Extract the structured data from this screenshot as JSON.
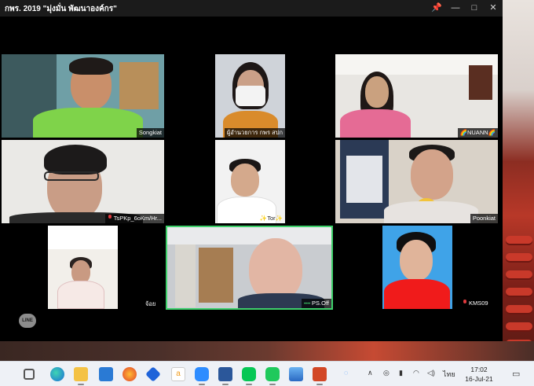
{
  "window": {
    "title": "กพร. 2019 \"มุ่งมั่น พัฒนาองค์กร\"",
    "controls": [
      "pin",
      "minimize",
      "maximize",
      "close"
    ]
  },
  "participants": [
    {
      "name": "Songkiat",
      "mic_muted": false,
      "active_speaker": false
    },
    {
      "name": "ผู้อำนวยการ กพร สปก",
      "mic_muted": false,
      "active_speaker": false
    },
    {
      "name": "🌈NUANN🌈",
      "mic_muted": false,
      "active_speaker": false
    },
    {
      "name": "TsPKp_6oKm/Hr...",
      "mic_muted": true,
      "active_speaker": false
    },
    {
      "name": "✨Tor✨",
      "mic_muted": false,
      "active_speaker": false
    },
    {
      "name": "Poonkiat",
      "mic_muted": false,
      "active_speaker": false
    },
    {
      "name": "จ้อย",
      "mic_muted": false,
      "active_speaker": false
    },
    {
      "name": "PS.Off",
      "mic_muted": false,
      "active_speaker": true
    },
    {
      "name": "KMS09",
      "mic_muted": true,
      "active_speaker": false
    }
  ],
  "overlay": {
    "line_logo": "LINE"
  },
  "taskbar": {
    "apps": [
      "task-view",
      "edge",
      "file-explorer",
      "mail",
      "firefox",
      "dropbox",
      "amazon",
      "zoom",
      "word",
      "line",
      "phone",
      "photos",
      "powerpoint"
    ],
    "tray": {
      "language": "ไทย"
    },
    "clock": {
      "time": "17:02",
      "date": "16-Jul-21"
    }
  },
  "colors": {
    "active_speaker_border": "#3fd16b",
    "titlebar": "#1b1b1b",
    "taskbar": "#eef1f6"
  }
}
